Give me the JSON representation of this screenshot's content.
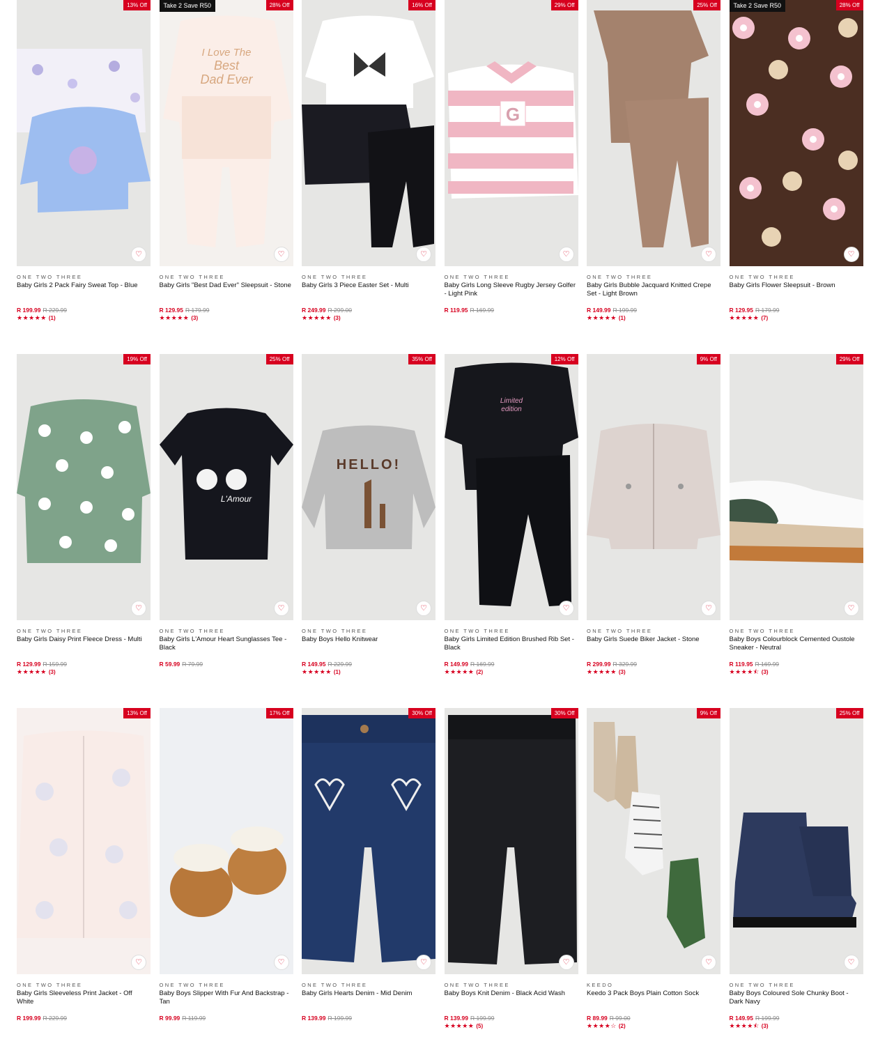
{
  "icons": {
    "wishlist": "heart-outline-icon",
    "star": "star-icon"
  },
  "colors": {
    "sale": "#d7001f",
    "promo": "#111111",
    "tile": "#e6e6e4"
  },
  "products": [
    {
      "brand": "ONE TWO THREE",
      "name": "Baby Girls 2 Pack Fairy Sweat Top - Blue",
      "price": "R 199.99",
      "was": "R 229.99",
      "discount": "13% Off",
      "promo": "",
      "rating": 5,
      "stars": "★★★★★",
      "reviews": "(1)",
      "art": "fairy"
    },
    {
      "brand": "ONE TWO THREE",
      "name": "Baby Girls \"Best Dad Ever\" Sleepsuit - Stone",
      "price": "R 129.95",
      "was": "R 179.99",
      "discount": "28% Off",
      "promo": "Take 2 Save R50",
      "rating": 5,
      "stars": "★★★★★",
      "reviews": "(3)",
      "art": "sleepsuit"
    },
    {
      "brand": "ONE TWO THREE",
      "name": "Baby Girls 3 Piece Easter Set - Multi",
      "price": "R 249.99",
      "was": "R 299.00",
      "discount": "16% Off",
      "promo": "",
      "rating": 5,
      "stars": "★★★★★",
      "reviews": "(3)",
      "art": "easter"
    },
    {
      "brand": "ONE TWO THREE",
      "name": "Baby Girls Long Sleeve Rugby Jersey Golfer - Light Pink",
      "price": "R 119.95",
      "was": "R 169.99",
      "discount": "29% Off",
      "promo": "",
      "rating": 0,
      "stars": "",
      "reviews": "",
      "art": "rugby"
    },
    {
      "brand": "ONE TWO THREE",
      "name": "Baby Girls Bubble Jacquard Knitted Crepe Set - Light Brown",
      "price": "R 149.99",
      "was": "R 199.99",
      "discount": "25% Off",
      "promo": "",
      "rating": 5,
      "stars": "★★★★★",
      "reviews": "(1)",
      "art": "brownset"
    },
    {
      "brand": "ONE TWO THREE",
      "name": "Baby Girls Flower Sleepsuit - Brown",
      "price": "R 129.95",
      "was": "R 179.99",
      "discount": "28% Off",
      "promo": "Take 2 Save R50",
      "rating": 5,
      "stars": "★★★★★",
      "reviews": "(7)",
      "art": "flower"
    },
    {
      "brand": "ONE TWO THREE",
      "name": "Baby Girls Daisy Print Fleece Dress - Multi",
      "price": "R 129.99",
      "was": "R 159.99",
      "discount": "19% Off",
      "promo": "",
      "rating": 5,
      "stars": "★★★★★",
      "reviews": "(3)",
      "art": "daisy"
    },
    {
      "brand": "ONE TWO THREE",
      "name": "Baby Girls L'Amour Heart Sunglasses Tee - Black",
      "price": "R 59.99",
      "was": "R 79.99",
      "discount": "25% Off",
      "promo": "",
      "rating": 0,
      "stars": "",
      "reviews": "",
      "art": "tee"
    },
    {
      "brand": "ONE TWO THREE",
      "name": "Baby Boys Hello Knitwear",
      "price": "R 149.95",
      "was": "R 229.99",
      "discount": "35% Off",
      "promo": "",
      "rating": 5,
      "stars": "★★★★★",
      "reviews": "(1)",
      "art": "knit"
    },
    {
      "brand": "ONE TWO THREE",
      "name": "Baby Girls Limited Edition Brushed Rib Set - Black",
      "price": "R 149.99",
      "was": "R 169.99",
      "discount": "12% Off",
      "promo": "",
      "rating": 5,
      "stars": "★★★★★",
      "reviews": "(2)",
      "art": "ribset"
    },
    {
      "brand": "ONE TWO THREE",
      "name": "Baby Girls Suede Biker Jacket - Stone",
      "price": "R 299.99",
      "was": "R 329.99",
      "discount": "9% Off",
      "promo": "",
      "rating": 5,
      "stars": "★★★★★",
      "reviews": "(3)",
      "art": "biker"
    },
    {
      "brand": "ONE TWO THREE",
      "name": "Baby Boys Colourblock Cemented Oustole Sneaker - Neutral",
      "price": "R 119.95",
      "was": "R 169.99",
      "discount": "29% Off",
      "promo": "",
      "rating": 4.5,
      "stars": "★★★★⯪",
      "reviews": "(3)",
      "art": "sneaker"
    },
    {
      "brand": "ONE TWO THREE",
      "name": "Baby Girls Sleeveless Print Jacket - Off White",
      "price": "R 199.99",
      "was": "R 229.99",
      "discount": "13% Off",
      "promo": "",
      "rating": 0,
      "stars": "",
      "reviews": "",
      "art": "vest"
    },
    {
      "brand": "ONE TWO THREE",
      "name": "Baby Boys Slipper With Fur And Backstrap - Tan",
      "price": "R 99.99",
      "was": "R 119.99",
      "discount": "17% Off",
      "promo": "",
      "rating": 0,
      "stars": "",
      "reviews": "",
      "art": "slipper"
    },
    {
      "brand": "ONE TWO THREE",
      "name": "Baby Girls Hearts Denim - Mid Denim",
      "price": "R 139.99",
      "was": "R 199.99",
      "discount": "30% Off",
      "promo": "",
      "rating": 0,
      "stars": "",
      "reviews": "",
      "art": "denim"
    },
    {
      "brand": "ONE TWO THREE",
      "name": "Baby Boys Knit Denim - Black Acid Wash",
      "price": "R 139.99",
      "was": "R 199.99",
      "discount": "30% Off",
      "promo": "",
      "rating": 5,
      "stars": "★★★★★",
      "reviews": "(5)",
      "art": "blackjean"
    },
    {
      "brand": "KEEDO",
      "name": "Keedo 3 Pack Boys Plain Cotton Sock",
      "price": "R 89.99",
      "was": "R 99.00",
      "discount": "9% Off",
      "promo": "",
      "rating": 4,
      "stars": "★★★★☆",
      "reviews": "(2)",
      "art": "socks"
    },
    {
      "brand": "ONE TWO THREE",
      "name": "Baby Boys Coloured Sole Chunky Boot - Dark Navy",
      "price": "R 149.95",
      "was": "R 199.99",
      "discount": "25% Off",
      "promo": "",
      "rating": 4.5,
      "stars": "★★★★⯪",
      "reviews": "(3)",
      "art": "boot"
    }
  ]
}
